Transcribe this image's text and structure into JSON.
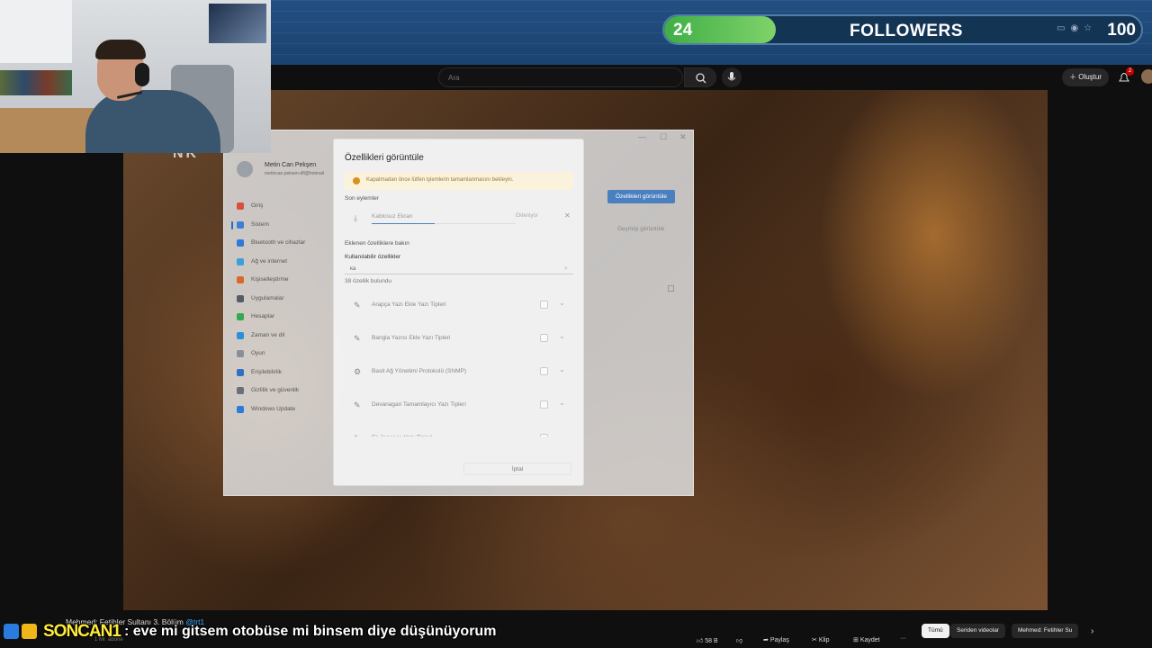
{
  "stream": {
    "followers_count": "24",
    "followers_label": "FOLLOWERS",
    "followers_goal": "100",
    "progress_fraction": 0.24
  },
  "youtube": {
    "search_placeholder": "Ara",
    "create_label": "Oluştur",
    "notification_badge": "2",
    "video_title": "Mehmed: Fetihler Sultanı 3. Bölüm",
    "channel_handle": "@trt1",
    "subscriber_label": "1 Mr. abone",
    "actions": {
      "like_count": "58 B",
      "share": "Paylaş",
      "clip": "Klip",
      "save": "Kaydet"
    },
    "chips": [
      "Tümü",
      "Seriden videolar",
      "Mehmed: Fetihler Su"
    ]
  },
  "frame_title_text": "NK",
  "settings": {
    "account_name": "Metin Can Pekşen",
    "account_email": "metincan.peksen-dfl@hotmail",
    "nav": [
      {
        "label": "Giriş",
        "color": "#d94f3d"
      },
      {
        "label": "Sistem",
        "color": "#3f7ed8",
        "active": true
      },
      {
        "label": "Bluetooth ve cihazlar",
        "color": "#2b7bd9"
      },
      {
        "label": "Ağ ve internet",
        "color": "#3aa0d8"
      },
      {
        "label": "Kişiselleştirme",
        "color": "#d76a2a"
      },
      {
        "label": "Uygulamalar",
        "color": "#555c66"
      },
      {
        "label": "Hesaplar",
        "color": "#34a853"
      },
      {
        "label": "Zaman ve dil",
        "color": "#2b8fd9"
      },
      {
        "label": "Oyun",
        "color": "#8a8f96"
      },
      {
        "label": "Erişilebilirlik",
        "color": "#2e6fc9"
      },
      {
        "label": "Gizlilik ve güvenlik",
        "color": "#6b7078"
      },
      {
        "label": "Windows Update",
        "color": "#2b7bd9"
      }
    ],
    "view_features_button": "Özellikleri görüntüle",
    "history_link": "Geçmişi görüntüle"
  },
  "dialog": {
    "title": "Özellikleri görüntüle",
    "warning": "Kapatmadan önce lütfen işlemlerin tamamlanmasını bekleyin.",
    "recent_label": "Son eylemler",
    "recent_item": "Kablosuz Ekran",
    "recent_status": "Ekleniyor",
    "installed_link": "Eklenen özelliklere bakın",
    "available_label": "Kullanılabilir özellikler",
    "filter_value": "ka",
    "found_count": "38 özellik bulundu",
    "features": [
      "Arapça Yazı Ekle Yazı Tipleri",
      "Bangla Yazısı Ekle Yazı Tipleri",
      "Basit Ağ Yönetimi Protokolü (SNMP)",
      "Devanagari Tamamlayıcı Yazı Tipleri",
      "Ek Japonca Yazı Tipleri"
    ],
    "cancel": "İptal"
  },
  "chat": {
    "user": "SONCAN1",
    "message": ": eve mi gitsem otobüse mi binsem diye düşünüyorum"
  }
}
